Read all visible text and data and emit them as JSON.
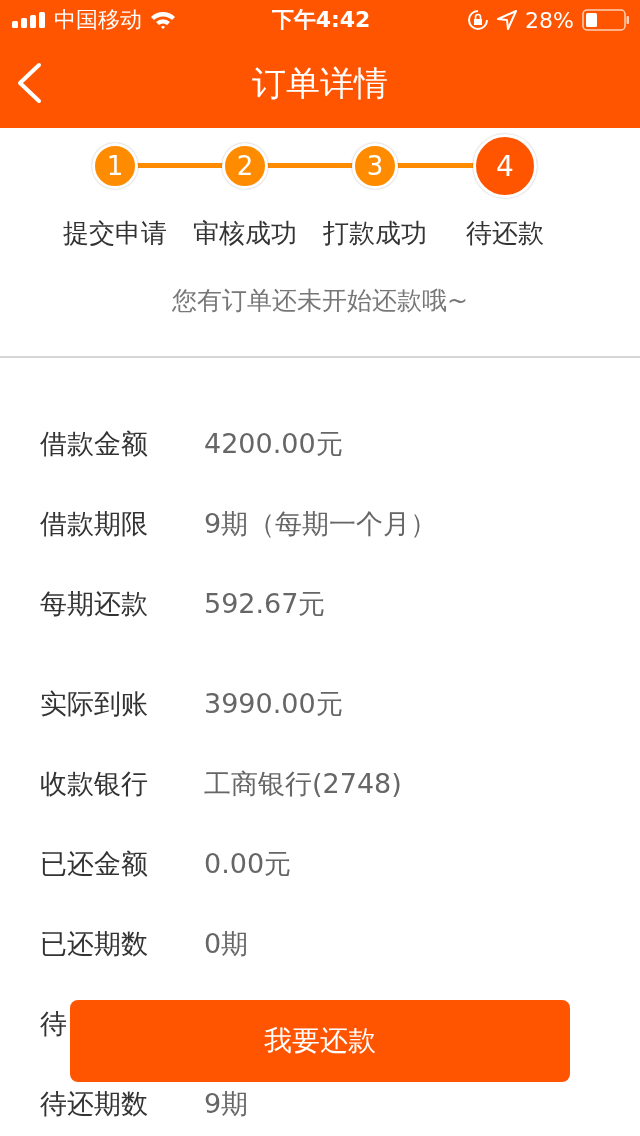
{
  "status_bar": {
    "carrier": "中国移动",
    "time": "下午4:42",
    "battery": "28%"
  },
  "nav": {
    "title": "订单详情"
  },
  "steps": [
    {
      "number": "1",
      "label": "提交申请",
      "current": false
    },
    {
      "number": "2",
      "label": "审核成功",
      "current": false
    },
    {
      "number": "3",
      "label": "打款成功",
      "current": false
    },
    {
      "number": "4",
      "label": "待还款",
      "current": true
    }
  ],
  "notice": "您有订单还未开始还款哦~",
  "groups": [
    [
      {
        "label": "借款金额",
        "value": "4200.00元"
      },
      {
        "label": "借款期限",
        "value": "9期（每期一个月）"
      },
      {
        "label": "每期还款",
        "value": "592.67元"
      }
    ],
    [
      {
        "label": "实际到账",
        "value": "3990.00元"
      },
      {
        "label": "收款银行",
        "value": "工商银行(2748)"
      },
      {
        "label": "已还金额",
        "value": "0.00元"
      },
      {
        "label": "已还期数",
        "value": "0期"
      },
      {
        "label": "待"
      },
      {
        "label": "待还期数",
        "value": "9期"
      }
    ]
  ],
  "button": "我要还款"
}
